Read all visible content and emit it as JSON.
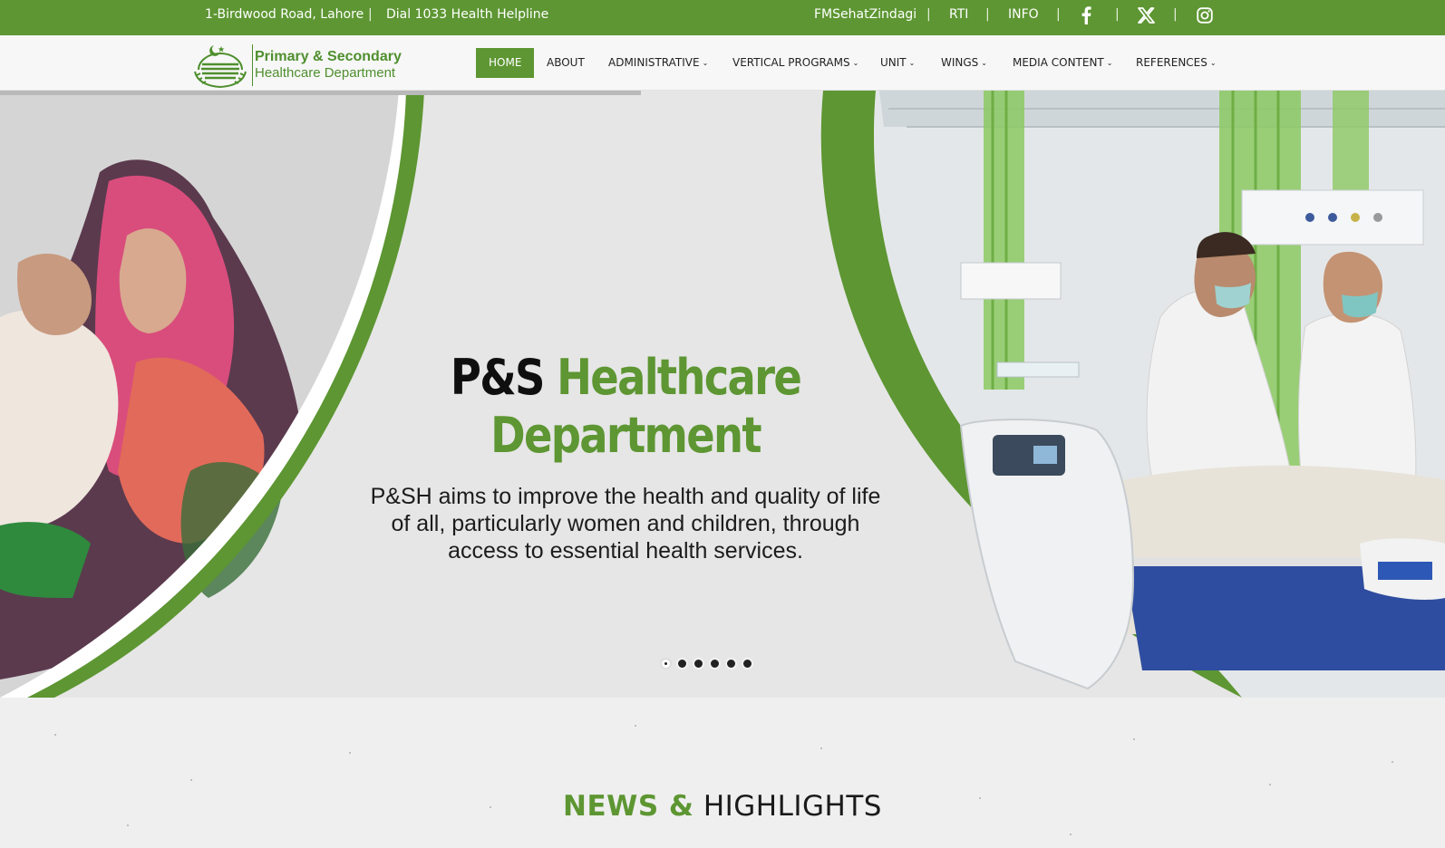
{
  "topbar": {
    "address": "1-Birdwood Road, Lahore",
    "separator": "|",
    "helpline": "Dial 1033 Health Helpline",
    "links": [
      "FMSehatZindagi",
      "RTI",
      "INFO"
    ],
    "social_icons": [
      "facebook-icon",
      "x-twitter-icon",
      "instagram-icon"
    ]
  },
  "logo": {
    "line1": "Primary & Secondary",
    "line2": "Healthcare Department"
  },
  "nav": {
    "items": [
      {
        "label": "HOME",
        "dropdown": false,
        "active": true
      },
      {
        "label": "ABOUT",
        "dropdown": false
      },
      {
        "label": "ADMINISTRATIVE",
        "dropdown": true
      },
      {
        "label": "VERTICAL PROGRAMS",
        "dropdown": true
      },
      {
        "label": "UNIT",
        "dropdown": true
      },
      {
        "label": "WINGS",
        "dropdown": true
      },
      {
        "label": "MEDIA CONTENT",
        "dropdown": true
      },
      {
        "label": "REFERENCES",
        "dropdown": true
      }
    ],
    "caret": "⌄"
  },
  "hero": {
    "title_part1": "P&S",
    "title_part2": "Healthcare",
    "title_part3": "Department",
    "subtitle": "P&SH aims to improve the health and quality of life of all, particularly women and children, through access to essential health services.",
    "slide_count": 6,
    "active_slide": 1
  },
  "news": {
    "heading_part1": "NEWS &",
    "heading_part2": "HIGHLIGHTS"
  },
  "colors": {
    "brand_green": "#5d9632",
    "topbar_bg": "#5d9632",
    "hero_bg": "#e6e6e6"
  }
}
